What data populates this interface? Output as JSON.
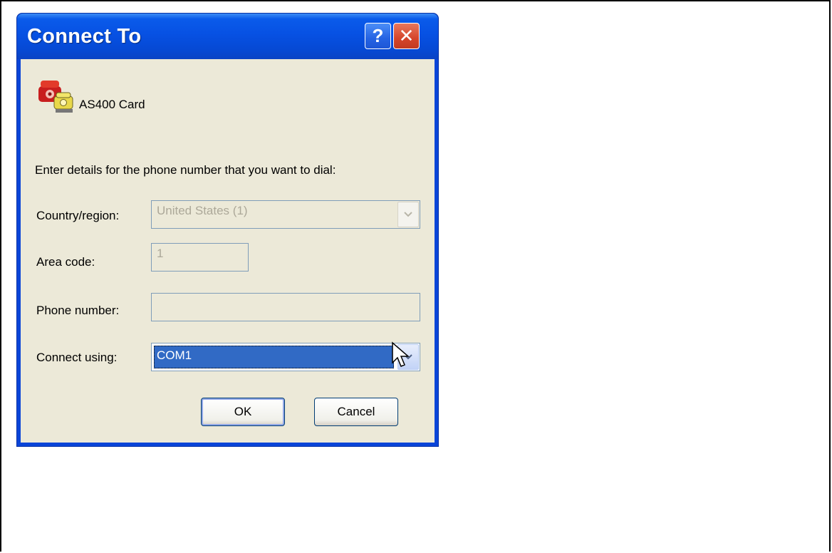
{
  "window": {
    "title": "Connect To",
    "help_label": "?",
    "close_label": "✕"
  },
  "connection": {
    "name": "AS400 Card",
    "icon": "telephone-connection-icon"
  },
  "instruction": "Enter details for the phone number that you want to dial:",
  "fields": {
    "country_label": "Country/region:",
    "country_value": "United States (1)",
    "area_code_label": "Area code:",
    "area_code_value": "1",
    "phone_label": "Phone number:",
    "phone_value": "",
    "connect_using_label": "Connect using:",
    "connect_using_value": "COM1"
  },
  "buttons": {
    "ok_label": "OK",
    "cancel_label": "Cancel"
  },
  "colors": {
    "title_bar": "#0751e3",
    "dialog_face": "#ece9d8",
    "selection": "#316ac5",
    "close_button": "#d5452a"
  }
}
